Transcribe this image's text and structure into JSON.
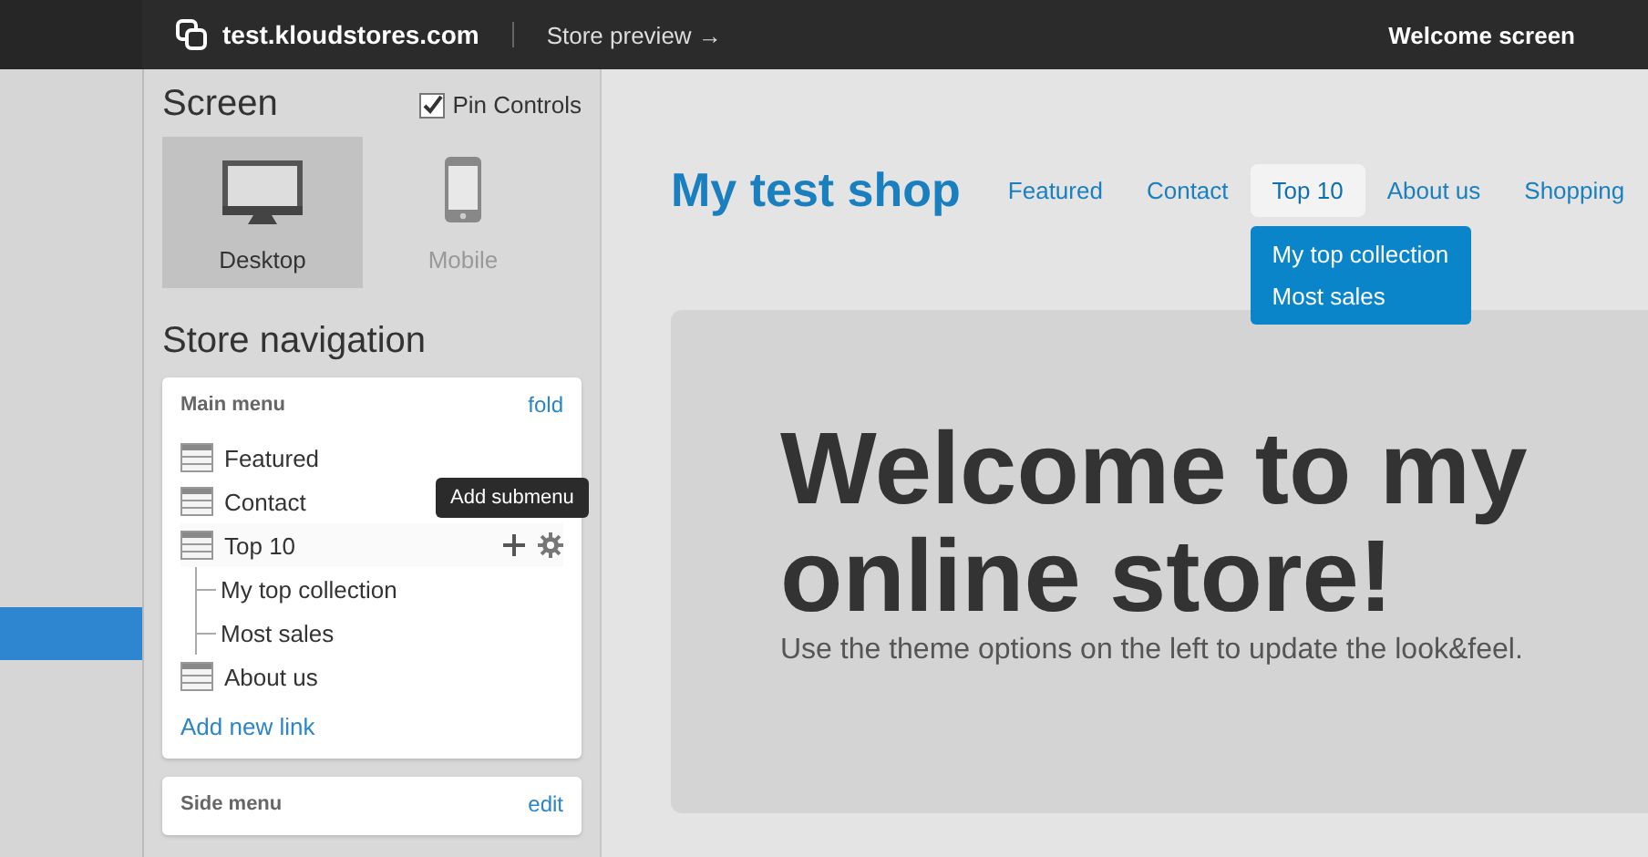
{
  "topbar": {
    "site": "test.kloudstores.com",
    "preview_link": "Store preview →",
    "screen_title": "Welcome screen"
  },
  "sidebar": {
    "screen_heading": "Screen",
    "pin_controls": {
      "label": "Pin Controls",
      "checked": true
    },
    "devices": [
      {
        "label": "Desktop",
        "kind": "desktop",
        "selected": true
      },
      {
        "label": "Mobile",
        "kind": "mobile",
        "selected": false
      }
    ],
    "nav_heading": "Store navigation",
    "main_menu": {
      "title": "Main menu",
      "action": "fold",
      "items": [
        {
          "label": "Featured",
          "hovered": false
        },
        {
          "label": "Contact",
          "hovered": false
        },
        {
          "label": "Top 10",
          "hovered": true,
          "children": [
            {
              "label": "My top collection"
            },
            {
              "label": "Most sales"
            }
          ]
        },
        {
          "label": "About us",
          "hovered": false
        }
      ],
      "tooltip": "Add submenu",
      "add_link": "Add new link"
    },
    "side_menu": {
      "title": "Side menu",
      "action": "edit"
    }
  },
  "preview": {
    "shop_title": "My test shop",
    "nav": [
      {
        "label": "Featured",
        "selected": false
      },
      {
        "label": "Contact",
        "selected": false
      },
      {
        "label": "Top 10",
        "selected": true,
        "dropdown": [
          "My top collection",
          "Most sales"
        ]
      },
      {
        "label": "About us",
        "selected": false
      },
      {
        "label": "Shopping",
        "selected": false
      }
    ],
    "hero_title": "Welcome to my online store!",
    "hero_text": "Use the theme options on the left to update the look&feel."
  }
}
